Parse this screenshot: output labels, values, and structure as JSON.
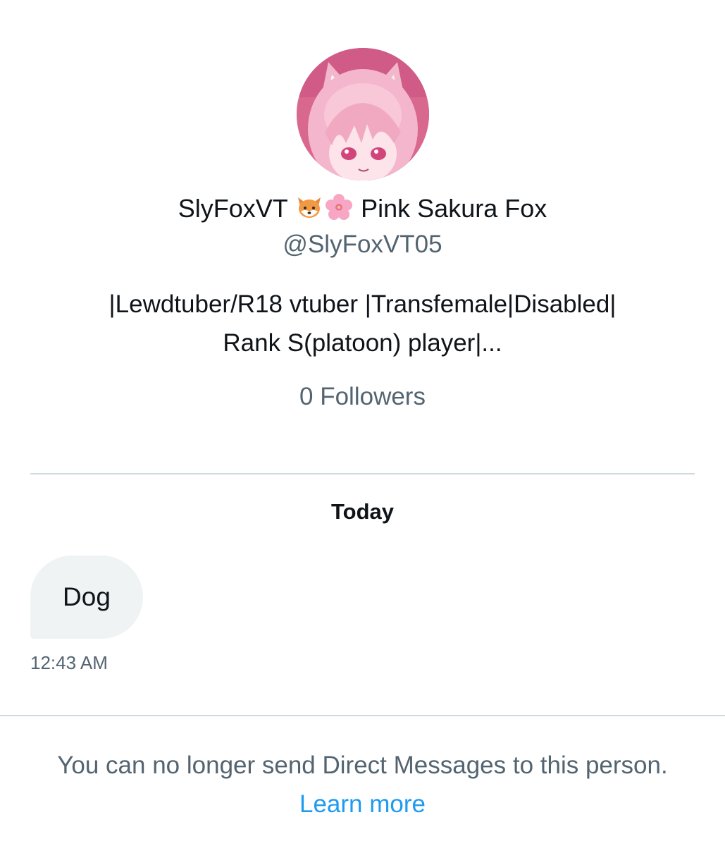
{
  "profile": {
    "display_name_text": "SlyFoxVT",
    "display_name_suffix": "Pink Sakura Fox",
    "emoji_icons": [
      "fox-face-emoji",
      "cherry-blossom-emoji"
    ],
    "handle": "@SlyFoxVT05",
    "bio_line_1": "|Lewdtuber/R18 vtuber |Transfemale|Disabled|",
    "bio_line_2": "Rank S(platoon) player|...",
    "followers_text": "0 Followers"
  },
  "conversation": {
    "date_label": "Today",
    "messages": [
      {
        "text": "Dog",
        "time": "12:43 AM"
      }
    ]
  },
  "footer": {
    "notice_text": "You can no longer send Direct Messages to this person.",
    "learn_more_label": "Learn more"
  },
  "colors": {
    "primary_text": "#0f1419",
    "secondary_text": "#536471",
    "link": "#1d9bf0",
    "bubble_bg": "#eff3f4",
    "divider": "#cfd9de"
  }
}
